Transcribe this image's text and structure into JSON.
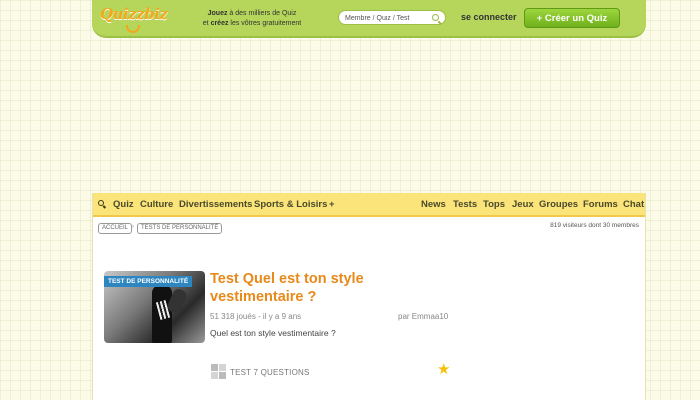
{
  "header": {
    "logo_text": "Quizzbiz",
    "tagline_line1_bold": "Jouez",
    "tagline_line1_rest": " à des milliers de Quiz",
    "tagline_line2_rest": "et ",
    "tagline_line2_bold": "créez",
    "tagline_line2_end": " les vôtres gratuitement",
    "search_placeholder": "Membre / Quiz / Test",
    "login_label": "se connecter",
    "create_button_label": "+ Créer un Quiz",
    "brand_color": "#b5d65a",
    "cta_color": "#6fb01d"
  },
  "nav": {
    "left_items": [
      "Quiz",
      "Culture",
      "Divertissements",
      "Sports & Loisirs",
      "+"
    ],
    "right_items": [
      "News",
      "Tests",
      "Tops",
      "Jeux",
      "Groupes",
      "Forums",
      "Chat"
    ],
    "bar_color": "#fbe47a"
  },
  "breadcrumb": {
    "items": [
      "ACCUEIL",
      "TESTS DE PERSONNALITÉ"
    ],
    "separator": "›"
  },
  "visitors_text": "819 visiteurs dont 30 membres",
  "quiz": {
    "badge": "TEST DE PERSONNALITÉ",
    "title": "Test Quel est ton style vestimentaire ?",
    "meta": "51 318 joués - il y a 9 ans",
    "author": "par Emmaa10",
    "description": "Quel est ton style vestimentaire ?",
    "type_label": "TEST 7 QUESTIONS",
    "title_color": "#e8891a",
    "star_icon": "star-icon"
  }
}
